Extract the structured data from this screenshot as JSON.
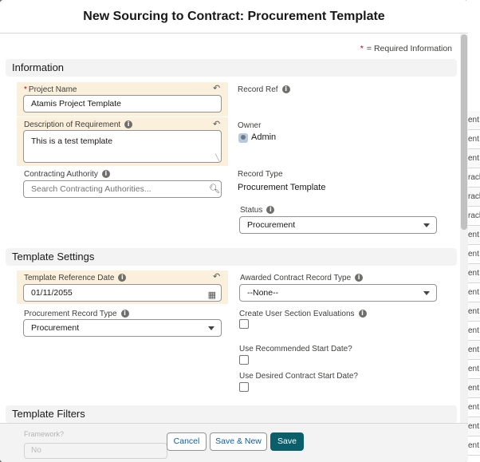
{
  "background_list": {
    "rows": [
      "ent",
      "ent",
      "ent",
      "ent",
      "racl",
      "racl",
      "racl",
      "ent",
      "ent",
      "ent",
      "ent",
      "ent",
      "ent",
      "ent",
      "ent",
      "ent",
      "ent",
      "ent",
      "ent",
      "ent",
      "ent",
      "ent",
      "ent"
    ]
  },
  "modal": {
    "title": "New Sourcing to Contract: Procurement Template",
    "required_note": "= Required Information",
    "required_star": "*"
  },
  "information": {
    "header": "Information",
    "project_name": {
      "label": "Project Name",
      "value": "Atamis Project Template"
    },
    "record_ref": {
      "label": "Record Ref"
    },
    "description": {
      "label": "Description of Requirement",
      "value": "This is a test template"
    },
    "owner": {
      "label": "Owner",
      "value": "Admin"
    },
    "contracting_authority": {
      "label": "Contracting Authority",
      "placeholder": "Search Contracting Authorities..."
    },
    "record_type": {
      "label": "Record Type",
      "value": "Procurement Template"
    },
    "status": {
      "label": "Status",
      "value": "Procurement"
    }
  },
  "template_settings": {
    "header": "Template Settings",
    "reference_date": {
      "label": "Template Reference Date",
      "value": "01/11/2055"
    },
    "awarded_contract_type": {
      "label": "Awarded Contract Record Type",
      "value": "--None--"
    },
    "procurement_record_type": {
      "label": "Procurement Record Type",
      "value": "Procurement"
    },
    "create_user_section_evaluations": {
      "label": "Create User Section Evaluations",
      "checked": false
    },
    "use_recommended_start": {
      "label": "Use Recommended Start Date?",
      "checked": false
    },
    "use_desired_contract_start": {
      "label": "Use Desired Contract Start Date?",
      "checked": false
    }
  },
  "template_filters": {
    "header": "Template Filters",
    "framework_label": "Framework?",
    "framework_value": "No"
  },
  "footer": {
    "cancel": "Cancel",
    "save_new": "Save & New",
    "save": "Save"
  },
  "colors": {
    "brand": "#0b5f6b",
    "highlight": "#faf0dc",
    "required": "#ba0517",
    "link": "#0b5cab"
  }
}
